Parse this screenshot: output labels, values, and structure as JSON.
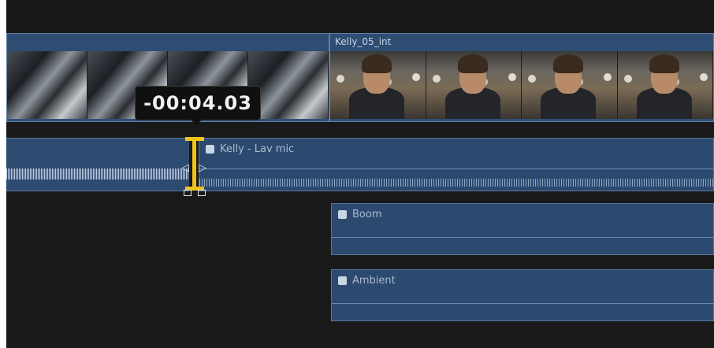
{
  "timeline": {
    "video_clips": [
      {
        "name": "",
        "type": "car-interior"
      },
      {
        "name": "Kelly_05_int",
        "type": "interview"
      }
    ],
    "timecode_overlay": "-00:04.03",
    "audio_clips": [
      {
        "name": "Kelly - Lav mic",
        "icon": "audio-clip-icon"
      },
      {
        "name": "Boom",
        "icon": "audio-clip-icon"
      },
      {
        "name": "Ambient",
        "icon": "audio-clip-icon"
      }
    ],
    "colors": {
      "background": "#1a1919",
      "clip_blue": "#2f4f76",
      "trim_handle": "#f0c21a"
    }
  }
}
